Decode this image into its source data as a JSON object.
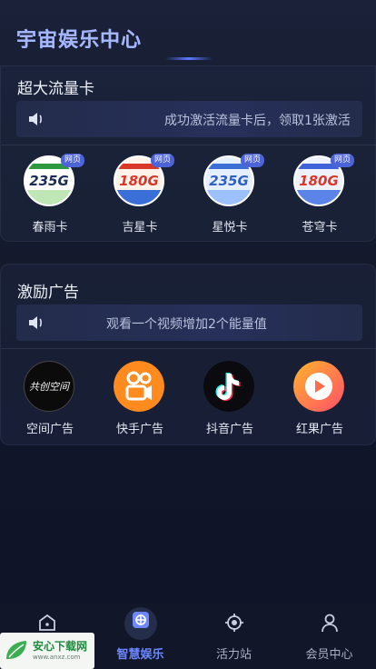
{
  "status_bar": {
    "time": "",
    "right": ""
  },
  "header": {
    "title": "宇宙娱乐中心"
  },
  "flow_section": {
    "title": "超大流量卡",
    "notice": "成功激活流量卡后，领取1张激活",
    "cards": [
      {
        "label": "春雨卡",
        "gb": "235G",
        "badge": "网页",
        "color": "#2e9a3e"
      },
      {
        "label": "吉星卡",
        "gb": "180G",
        "badge": "网页",
        "color": "#d8372a"
      },
      {
        "label": "星悦卡",
        "gb": "235G",
        "badge": "网页",
        "color": "#3b6fd6"
      },
      {
        "label": "苍穹卡",
        "gb": "180G",
        "badge": "网页",
        "color": "#3f62d8"
      }
    ]
  },
  "ad_section": {
    "title": "激励广告",
    "notice": "观看一个视频增加2个能量值",
    "ads": [
      {
        "label": "空间广告",
        "icon": "gongchuang-space-icon",
        "icon_text": "共创空间"
      },
      {
        "label": "快手广告",
        "icon": "kuaishou-icon"
      },
      {
        "label": "抖音广告",
        "icon": "douyin-icon"
      },
      {
        "label": "红果广告",
        "icon": "hongguo-play-icon"
      }
    ]
  },
  "bottom_nav": {
    "items": [
      {
        "label": "",
        "icon": "home-icon"
      },
      {
        "label": "智慧娱乐",
        "icon": "entertainment-icon",
        "active": true
      },
      {
        "label": "活力站",
        "icon": "target-icon"
      },
      {
        "label": "会员中心",
        "icon": "user-icon"
      }
    ]
  },
  "watermark": {
    "title": "安心下载网",
    "url": "www.anxz.com"
  },
  "colors": {
    "accent": "#6d87ff",
    "badge": "#4d64d8",
    "background": "#141a2c"
  }
}
